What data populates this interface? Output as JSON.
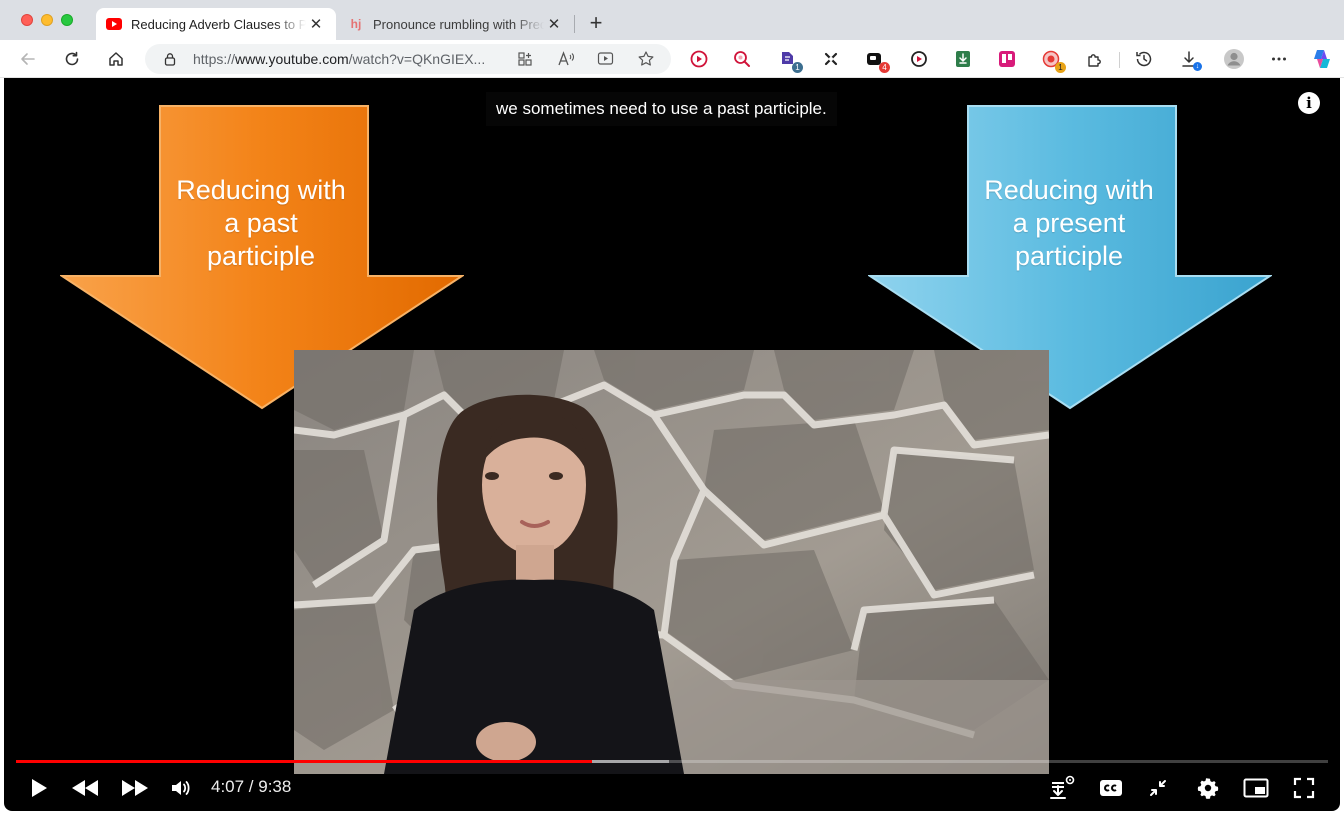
{
  "browser": {
    "tabs": [
      {
        "title": "Reducing Adverb Clauses to Participle Phrases",
        "favicon": "youtube-favicon",
        "active": true
      },
      {
        "title": "Pronounce rumbling with Precision",
        "favicon": "hj-favicon",
        "active": false
      }
    ],
    "url": {
      "scheme": "https://",
      "host": "www.youtube.com",
      "path": "/watch?v=QKnGIEX..."
    },
    "extensions": [
      {
        "icon": "play-circle-icon"
      },
      {
        "icon": "search-magnify-icon"
      },
      {
        "icon": "puzzle-badge-icon",
        "badge": "1"
      },
      {
        "icon": "cursor-sparkle-icon"
      },
      {
        "icon": "video-recorder-icon",
        "badge": "4"
      },
      {
        "icon": "screen-record-icon"
      },
      {
        "icon": "download-box-icon"
      },
      {
        "icon": "trello-icon"
      },
      {
        "icon": "red-circle-icon",
        "badge": "1"
      },
      {
        "icon": "extensions-icon"
      },
      {
        "icon": "history-icon"
      },
      {
        "icon": "downloads-icon"
      }
    ],
    "colors": {
      "tabstrip": "#dcdfe4",
      "accent": "#ff0000"
    }
  },
  "video": {
    "caption": "we sometimes need to use a past participle.",
    "left_arrow": {
      "lines": [
        "Reducing with",
        "a past",
        "participle"
      ],
      "color": "#f07a10"
    },
    "right_arrow": {
      "lines": [
        "Reducing with",
        "a present",
        "participle"
      ],
      "color": "#4fb6da"
    },
    "progress": {
      "played_fraction": 0.4387,
      "buffered_fraction": 0.498
    },
    "time": {
      "current": "4:07",
      "duration": "9:38",
      "display": "4:07 / 9:38"
    }
  }
}
